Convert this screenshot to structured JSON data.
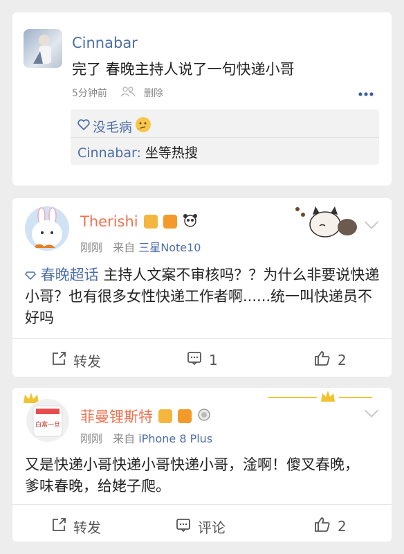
{
  "comment": {
    "user": "Cinnabar",
    "text": "完了 春晚主持人说了一句快递小哥",
    "time": "5分钟前",
    "delete_label": "删除",
    "reply_like_label": "没毛病",
    "reply_user": "Cinnabar:",
    "reply_text": "坐等热搜"
  },
  "post1": {
    "user": "Therishi",
    "time": "刚刚",
    "source_prefix": "来自",
    "source": "三星Note10",
    "topic": "春晚超话",
    "text": "主持人文案不审核吗？？为什么非要说快递小哥？也有很多女性快递工作者啊......统一叫快递员不好吗",
    "repost_label": "转发",
    "comment_count": "1",
    "like_count": "2",
    "colors": {
      "username": "#eb7350"
    }
  },
  "post2": {
    "user": "菲曼锂斯特",
    "avatar_text": "白富一旦",
    "time": "刚刚",
    "source_prefix": "来自",
    "source": "iPhone 8 Plus",
    "text": "又是快递小哥快递小哥快递小哥，淦啊！傻叉春晚，爹味春晚，给姥子爬。",
    "repost_label": "转发",
    "comment_label": "评论",
    "like_count": "2"
  }
}
